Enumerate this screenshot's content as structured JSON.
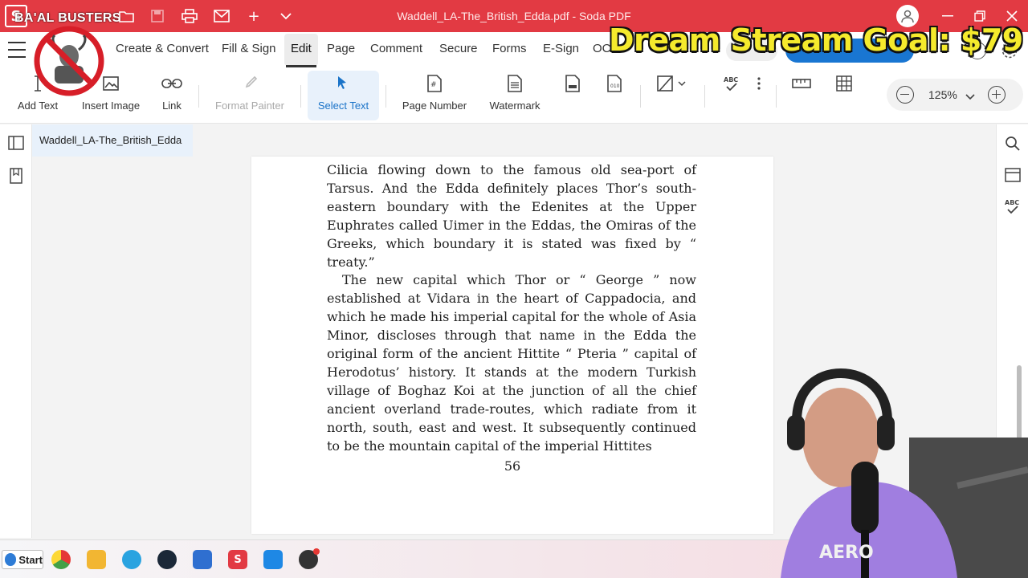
{
  "titlebar": {
    "overlay_brand": "BA'AL BUSTERS",
    "doc_title": "Waddell_LA-The_British_Edda.pdf  -  Soda PDF",
    "colors": {
      "bar": "#e23a43"
    }
  },
  "menu": {
    "items": [
      "Create & Convert",
      "Fill & Sign",
      "Edit",
      "Page",
      "Comment",
      "Secure",
      "Forms",
      "E-Sign",
      "OCR"
    ],
    "active": "Edit"
  },
  "ribbon": {
    "add_text": "Add Text",
    "insert_image": "Insert Image",
    "link": "Link",
    "format_painter": "Format Painter",
    "select_text": "Select Text",
    "page_number": "Page Number",
    "watermark": "Watermark",
    "zoom": "125%"
  },
  "document": {
    "tab_label": "Waddell_LA-The_British_Edda",
    "paragraph1": "Cilicia flowing down to the famous old sea-port of Tarsus. And the Edda definitely places Thor’s south-eastern boundary with the Edenites at the Upper Euphrates called Uimer in the Eddas, the Omiras of the Greeks, which boundary it is stated was fixed by “ treaty.”",
    "paragraph2": "The new capital which Thor or “ George ” now established at Vidara in the heart of Cappadocia, and which he made his imperial capital for the whole of Asia Minor, discloses through that name in the Edda the original form of the ancient Hittite “ Pteria ” capital of Herodotus’ history. It stands at the modern Turkish village of Boghaz Koi at the junction of all the chief ancient overland trade-routes, which radiate from it north, south, east and west. It subsequently continued to be the mountain capital of the imperial Hittites",
    "page_number": "56"
  },
  "overlay": {
    "goal_text": "Dream Stream Goal: $79"
  },
  "taskbar": {
    "start_label": "Start",
    "soda_label": "S"
  }
}
